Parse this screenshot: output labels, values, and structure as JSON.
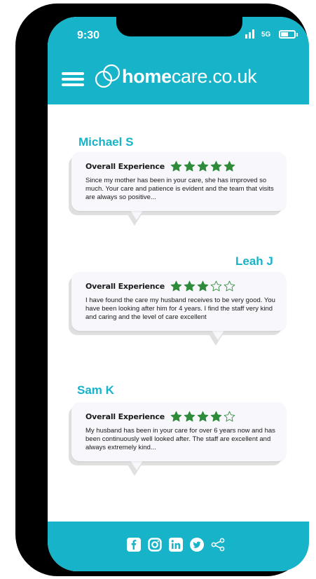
{
  "status_bar": {
    "time": "9:30",
    "network": "5G"
  },
  "header": {
    "brand_bold": "home",
    "brand_rest": "care.co.uk"
  },
  "reviews": [
    {
      "name": "Michael S",
      "label": "Overall Experience",
      "rating": 5,
      "max_rating": 5,
      "text": "Since my mother has been in your care, she has improved so much. Your care and patience is evident and the team that visits are always so positive..."
    },
    {
      "name": "Leah J",
      "label": "Overall Experience",
      "rating": 3,
      "max_rating": 5,
      "text": "I have found the care my husband receives to be very good. You have been looking after him for 4 years. I find the staff very kind and caring and the level of care excellent"
    },
    {
      "name": "Sam K",
      "label": "Overall Experience",
      "rating": 4,
      "max_rating": 5,
      "text": "My husband has been in your care for over 6 years now and has been continuously well looked after. The staff are excellent and always extremely kind..."
    }
  ],
  "footer": {
    "icons": [
      "facebook-icon",
      "instagram-icon",
      "linkedin-icon",
      "twitter-icon",
      "share-icon"
    ]
  },
  "colors": {
    "brand": "#17b3c9",
    "star": "#2e8b3a",
    "bubble": "#f7f7fc"
  }
}
